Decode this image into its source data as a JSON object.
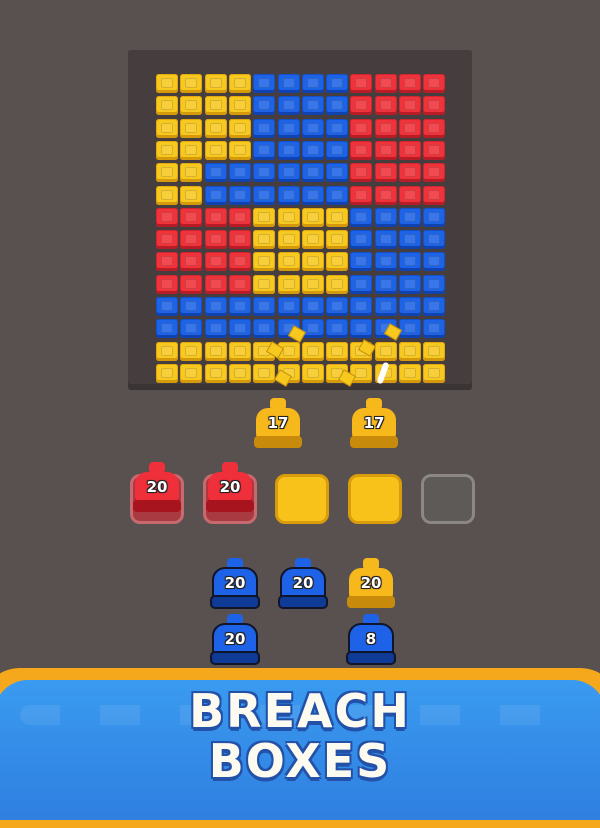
{
  "colors": {
    "background": "#595050",
    "board_frame": "#463e3e",
    "yellow": "#f7c91f",
    "blue": "#1d63e8",
    "red": "#f0333a",
    "banner_border": "#f5a81c",
    "banner_fill": "#3a9bf0"
  },
  "board": {
    "rows": [
      "YYYYBBBBRRRR",
      "YYYYBBBBRRRR",
      "YYYYBBBBRRRR",
      "YYYYBBBBRRRR",
      "YYBBBBBBRRRR",
      "YYBBBBBBRRRR",
      "RRRRYYYYBBBB",
      "RRRRYYYYBBBB",
      "RRRRYYYYBBBB",
      "RRRRYYYYBBBB",
      "BBBBBBBBBBBB",
      "BBBBBBBBBBBB",
      "YYYYYYYYYYYY",
      "YYYYYYYYYYYY"
    ]
  },
  "active_cannons": [
    {
      "color": "yellow",
      "count": "17",
      "icon": "cannon-icon"
    },
    {
      "color": "yellow",
      "count": "17",
      "icon": "cannon-icon"
    }
  ],
  "slots": [
    {
      "state": "red",
      "count": "20"
    },
    {
      "state": "red",
      "count": "20"
    },
    {
      "state": "yellow",
      "count": ""
    },
    {
      "state": "yellow",
      "count": ""
    },
    {
      "state": "empty",
      "count": ""
    }
  ],
  "queue": {
    "front_row": [
      {
        "color": "blue",
        "count": "20"
      },
      {
        "color": "blue",
        "count": "20"
      },
      {
        "color": "yellow",
        "count": "20"
      }
    ],
    "back_row": [
      {
        "color": "blue",
        "count": "20"
      },
      {
        "color": "blue",
        "count": "8"
      }
    ]
  },
  "banner": {
    "line1": "BREACH",
    "line2": "BOXES"
  }
}
